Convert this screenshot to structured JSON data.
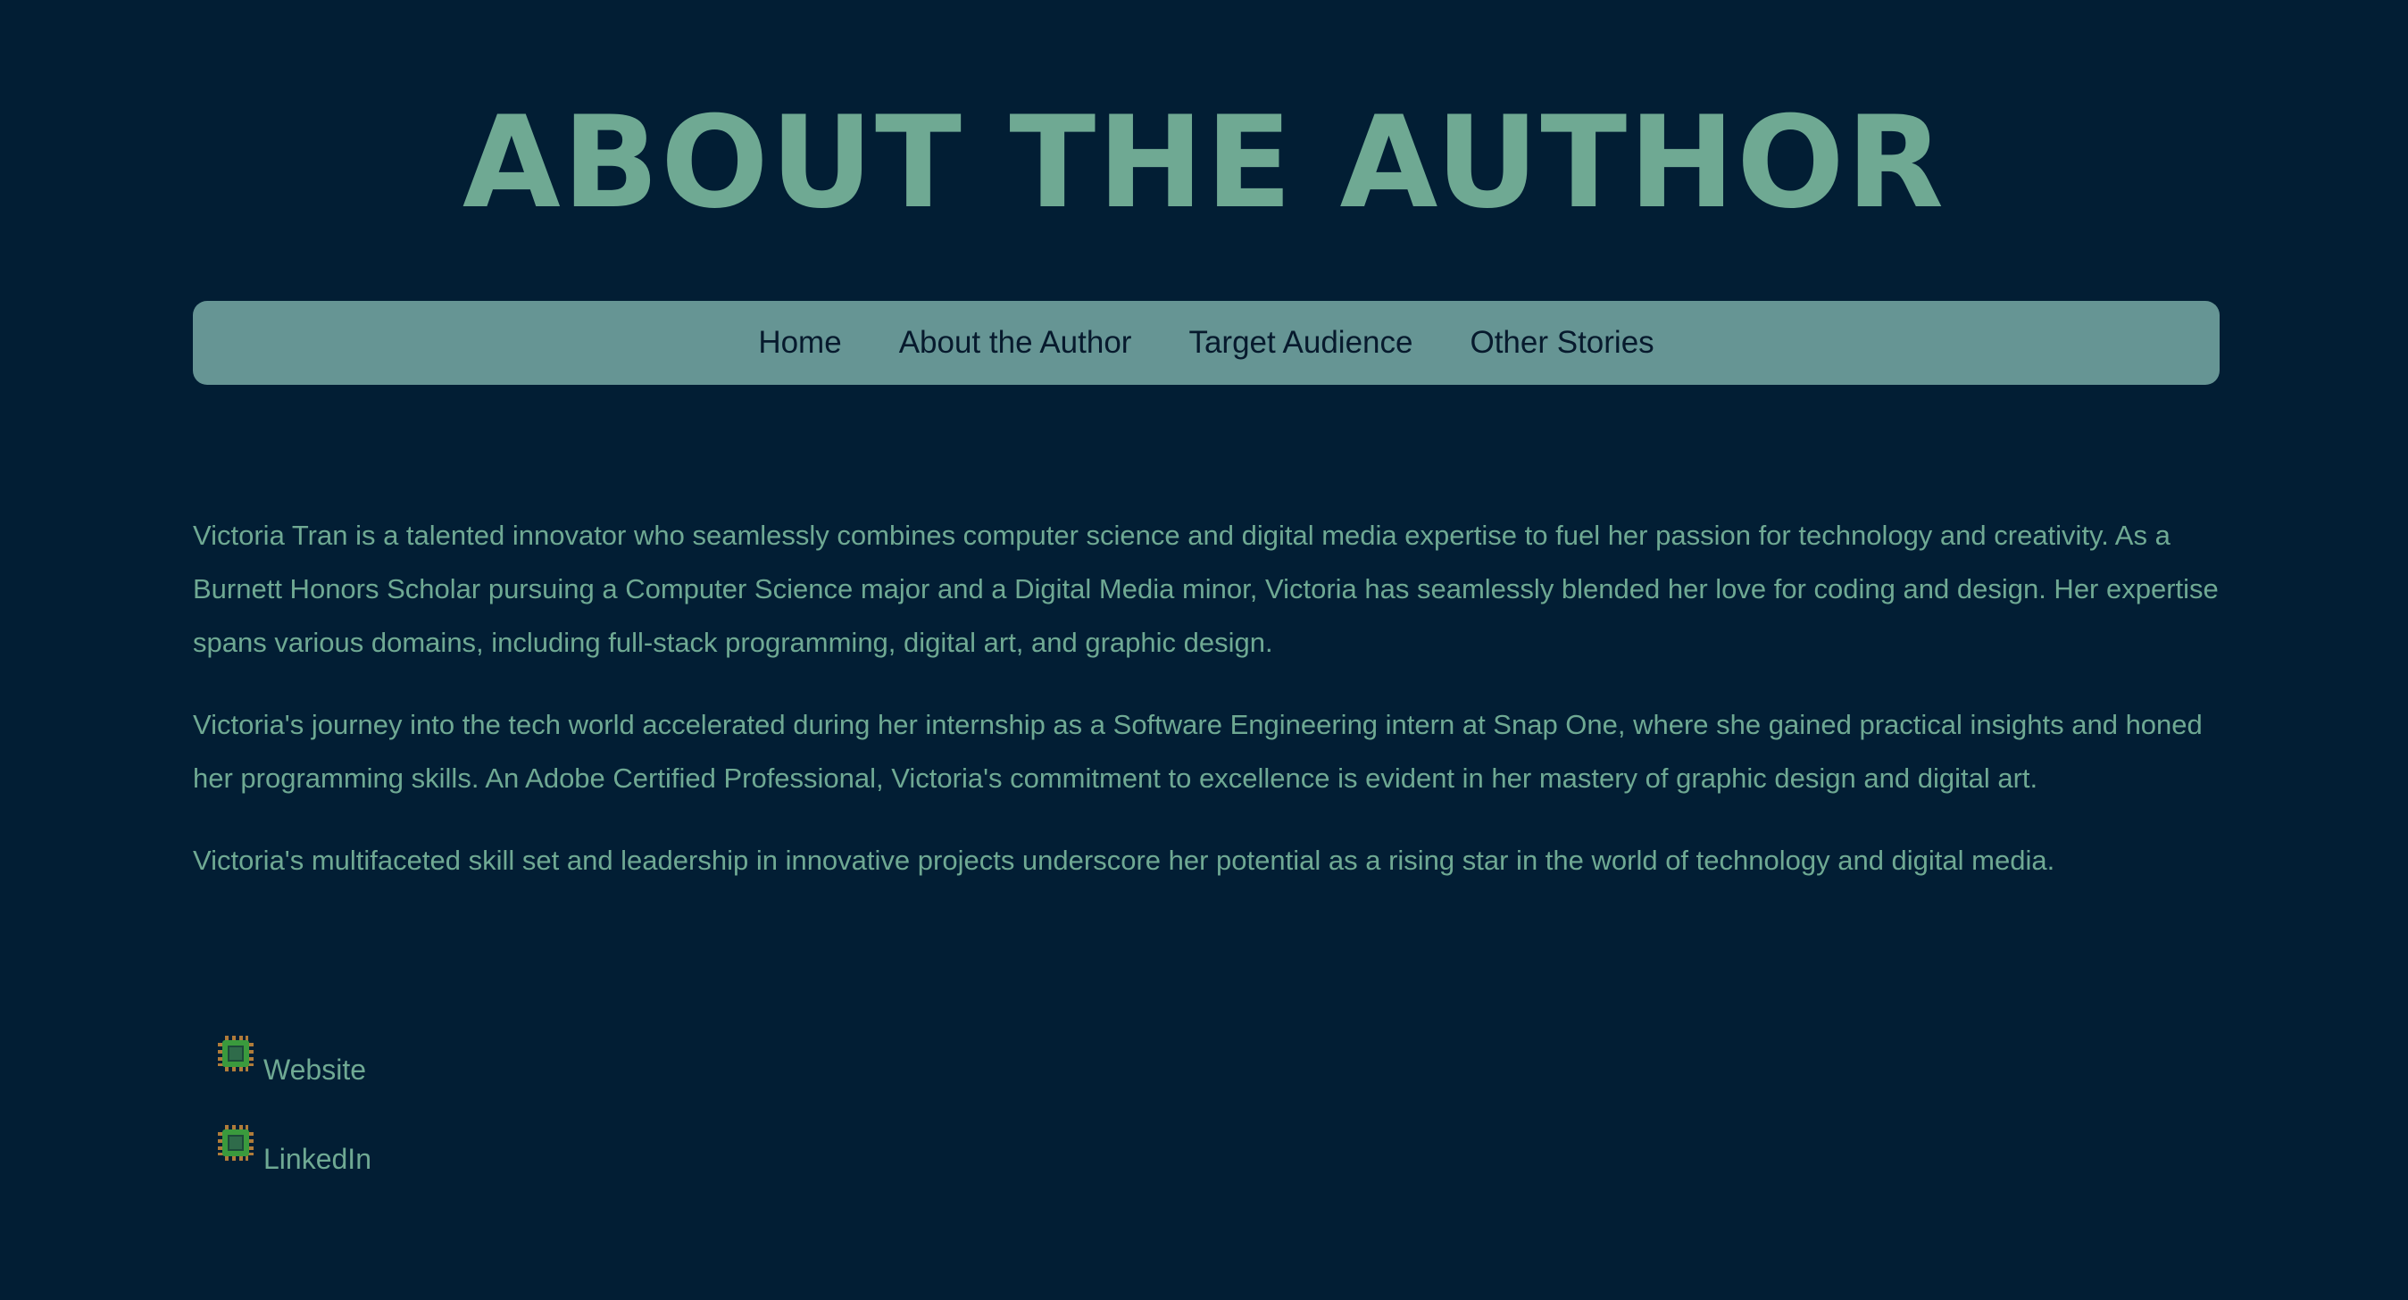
{
  "page": {
    "title": "ABOUT THE AUTHOR"
  },
  "nav": {
    "items": [
      {
        "label": "Home"
      },
      {
        "label": "About the Author"
      },
      {
        "label": "Target Audience"
      },
      {
        "label": "Other Stories"
      }
    ]
  },
  "content": {
    "paragraphs": [
      "Victoria Tran is a talented innovator who seamlessly combines computer science and digital media expertise to fuel her passion for technology and creativity. As a Burnett Honors Scholar pursuing a Computer Science major and a Digital Media minor, Victoria has seamlessly blended her love for coding and design. Her expertise spans various domains, including full-stack programming, digital art, and graphic design.",
      "Victoria's journey into the tech world accelerated during her internship as a Software Engineering intern at Snap One, where she gained practical insights and honed her programming skills. An Adobe Certified Professional, Victoria's commitment to excellence is evident in her mastery of graphic design and digital art.",
      "Victoria's multifaceted skill set and leadership in innovative projects underscore her potential as a rising star in the world of technology and digital media."
    ]
  },
  "links": {
    "items": [
      {
        "label": "Website",
        "icon": "microchip-icon"
      },
      {
        "label": "LinkedIn",
        "icon": "microchip-icon"
      }
    ]
  },
  "colors": {
    "background": "#021e34",
    "accent": "#6fa993",
    "navbar": "#669594",
    "nav_text": "#071a2d",
    "chip_green": "#3a9a3d",
    "chip_pins": "#b07c3a"
  }
}
